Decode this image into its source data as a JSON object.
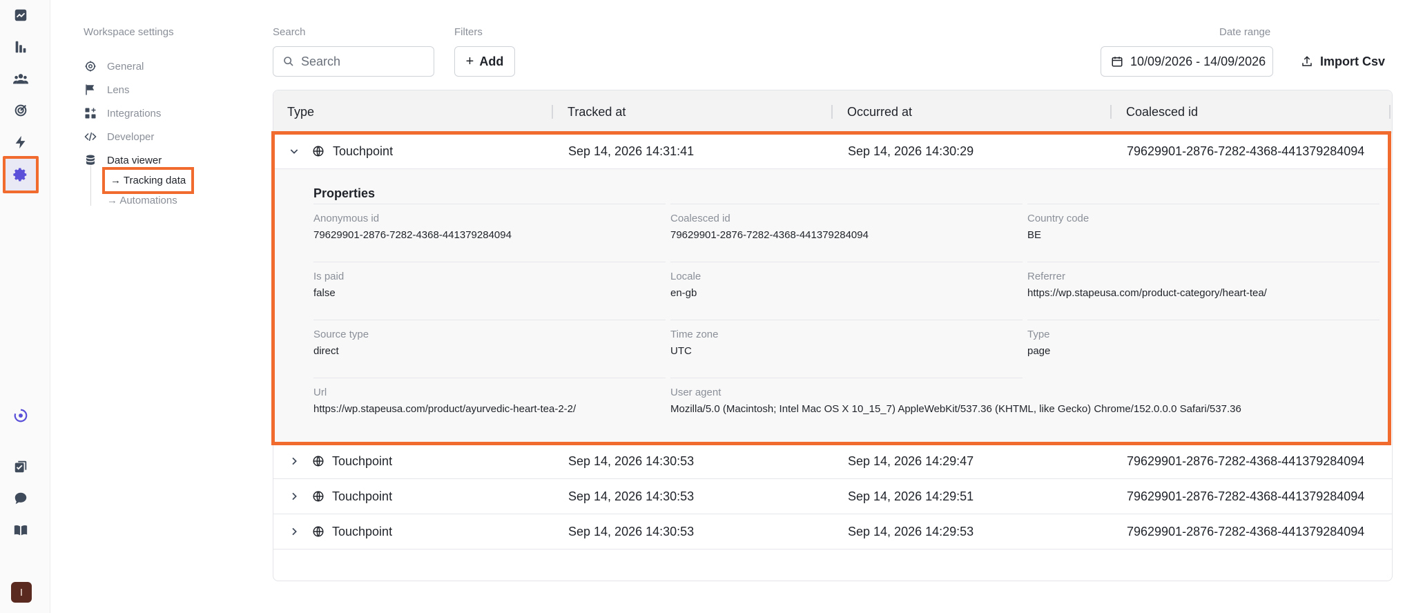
{
  "rail": {
    "icons": [
      "analytics-icon",
      "bar-chart-icon",
      "users-icon",
      "target-icon",
      "lightning-icon",
      "settings-icon",
      "loading-icon",
      "checklist-icon",
      "chat-icon",
      "book-icon"
    ],
    "avatar_letter": "I",
    "active_color": "#f26b2e"
  },
  "nav": {
    "heading": "Workspace settings",
    "items": [
      {
        "label": "General",
        "icon": "gear-outline-icon"
      },
      {
        "label": "Lens",
        "icon": "flag-icon"
      },
      {
        "label": "Integrations",
        "icon": "grid-plus-icon"
      },
      {
        "label": "Developer",
        "icon": "code-icon"
      },
      {
        "label": "Data viewer",
        "icon": "database-icon"
      }
    ],
    "subitems": [
      {
        "label": "→ Tracking data",
        "active": true
      },
      {
        "label": "→ Automations",
        "active": false
      }
    ]
  },
  "toolbar": {
    "search_label": "Search",
    "search_placeholder": "Search",
    "filters_label": "Filters",
    "add_label": "Add",
    "date_range_label": "Date range",
    "date_range_value": "10/09/2026 - 14/09/2026",
    "import_label": "Import Csv"
  },
  "table": {
    "columns": [
      "Type",
      "Tracked at",
      "Occurred at",
      "Coalesced id"
    ],
    "expanded_row": {
      "type": "Touchpoint",
      "tracked_at": "Sep 14, 2026 14:31:41",
      "occurred_at": "Sep 14, 2026 14:30:29",
      "coalesced_id": "79629901-2876-7282-4368-441379284094",
      "properties_title": "Properties",
      "properties": [
        {
          "label": "Anonymous id",
          "value": "79629901-2876-7282-4368-441379284094"
        },
        {
          "label": "Coalesced id",
          "value": "79629901-2876-7282-4368-441379284094"
        },
        {
          "label": "Country code",
          "value": "BE"
        },
        {
          "label": "Is paid",
          "value": "false"
        },
        {
          "label": "Locale",
          "value": "en-gb"
        },
        {
          "label": "Referrer",
          "value": "https://wp.stapeusa.com/product-category/heart-tea/"
        },
        {
          "label": "Source type",
          "value": "direct"
        },
        {
          "label": "Time zone",
          "value": "UTC"
        },
        {
          "label": "Type",
          "value": "page"
        },
        {
          "label": "Url",
          "value": "https://wp.stapeusa.com/product/ayurvedic-heart-tea-2-2/"
        },
        {
          "label": "User agent",
          "value": "Mozilla/5.0 (Macintosh; Intel Mac OS X 10_15_7) AppleWebKit/537.36 (KHTML, like Gecko) Chrome/152.0.0.0 Safari/537.36"
        }
      ]
    },
    "rows": [
      {
        "type": "Touchpoint",
        "tracked_at": "Sep 14, 2026 14:30:53",
        "occurred_at": "Sep 14, 2026 14:29:47",
        "coalesced_id": "79629901-2876-7282-4368-441379284094"
      },
      {
        "type": "Touchpoint",
        "tracked_at": "Sep 14, 2026 14:30:53",
        "occurred_at": "Sep 14, 2026 14:29:51",
        "coalesced_id": "79629901-2876-7282-4368-441379284094"
      },
      {
        "type": "Touchpoint",
        "tracked_at": "Sep 14, 2026 14:30:53",
        "occurred_at": "Sep 14, 2026 14:29:53",
        "coalesced_id": "79629901-2876-7282-4368-441379284094"
      }
    ]
  }
}
